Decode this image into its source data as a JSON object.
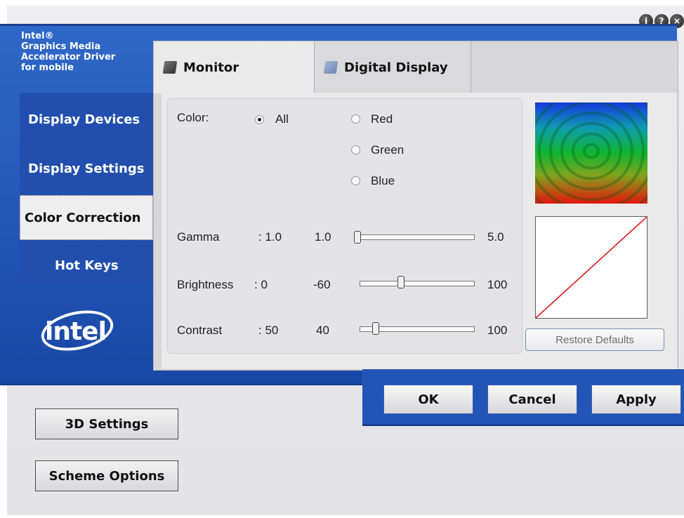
{
  "title_bar": {
    "info_glyph": "i",
    "help_glyph": "?",
    "close_glyph": "×"
  },
  "brand": {
    "line1": "Intel®",
    "line2": "Graphics Media",
    "line3": "Accelerator Driver",
    "line4": "for mobile"
  },
  "nav": {
    "items": [
      {
        "label": "Display Devices"
      },
      {
        "label": "Display Settings"
      },
      {
        "label": "Color Correction"
      },
      {
        "label": "Hot Keys"
      }
    ],
    "active_index": 2
  },
  "logo_text": "intel",
  "tabs": [
    {
      "label": "Monitor",
      "icon": "monitor-icon"
    },
    {
      "label": "Digital Display",
      "icon": "digital-display-icon"
    }
  ],
  "color": {
    "label": "Color:",
    "options": [
      "All",
      "Red",
      "Green",
      "Blue"
    ],
    "selected": "All"
  },
  "sliders": {
    "gamma": {
      "label": "Gamma",
      "value": ": 1.0",
      "min": "1.0",
      "max": "5.0"
    },
    "brightness": {
      "label": "Brightness",
      "value": ": 0",
      "min": "-60",
      "max": "100"
    },
    "contrast": {
      "label": "Contrast",
      "value": ": 50",
      "min": "40",
      "max": "100"
    }
  },
  "restore_defaults": "Restore Defaults",
  "buttons": {
    "ok": "OK",
    "cancel": "Cancel",
    "apply": "Apply",
    "settings_3d": "3D Settings",
    "scheme_options": "Scheme Options"
  },
  "colors": {
    "accent_blue": "#2355b8",
    "panel_gray": "#eaeaea",
    "curve_red": "#e0181b"
  }
}
